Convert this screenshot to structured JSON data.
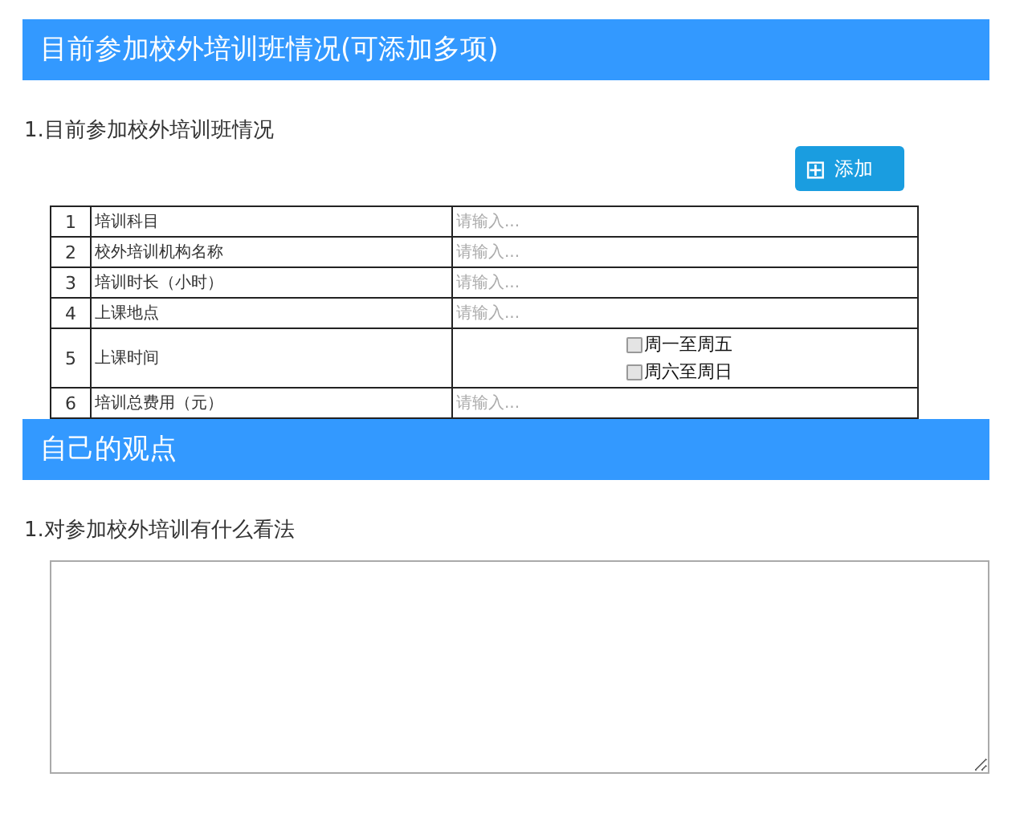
{
  "sections": [
    {
      "title": "目前参加校外培训班情况(可添加多项)",
      "question": "1.目前参加校外培训班情况",
      "add_button": {
        "icon": "⊞",
        "label": "添加"
      },
      "rows": [
        {
          "number": "1",
          "label": "培训科目",
          "kind": "text",
          "placeholder": "请输入..."
        },
        {
          "number": "2",
          "label": "校外培训机构名称",
          "kind": "text",
          "placeholder": "请输入..."
        },
        {
          "number": "3",
          "label": "培训时长（小时）",
          "kind": "text",
          "placeholder": "请输入..."
        },
        {
          "number": "4",
          "label": "上课地点",
          "kind": "text",
          "placeholder": "请输入..."
        },
        {
          "number": "5",
          "label": "上课时间",
          "kind": "checks",
          "options": [
            {
              "label": "周一至周五",
              "checked": false
            },
            {
              "label": "周六至周日",
              "checked": false
            }
          ]
        },
        {
          "number": "6",
          "label": "培训总费用（元）",
          "kind": "text",
          "placeholder": "请输入..."
        }
      ]
    },
    {
      "title": "自己的观点",
      "question": "1.对参加校外培训有什么看法",
      "kind": "textarea"
    }
  ]
}
